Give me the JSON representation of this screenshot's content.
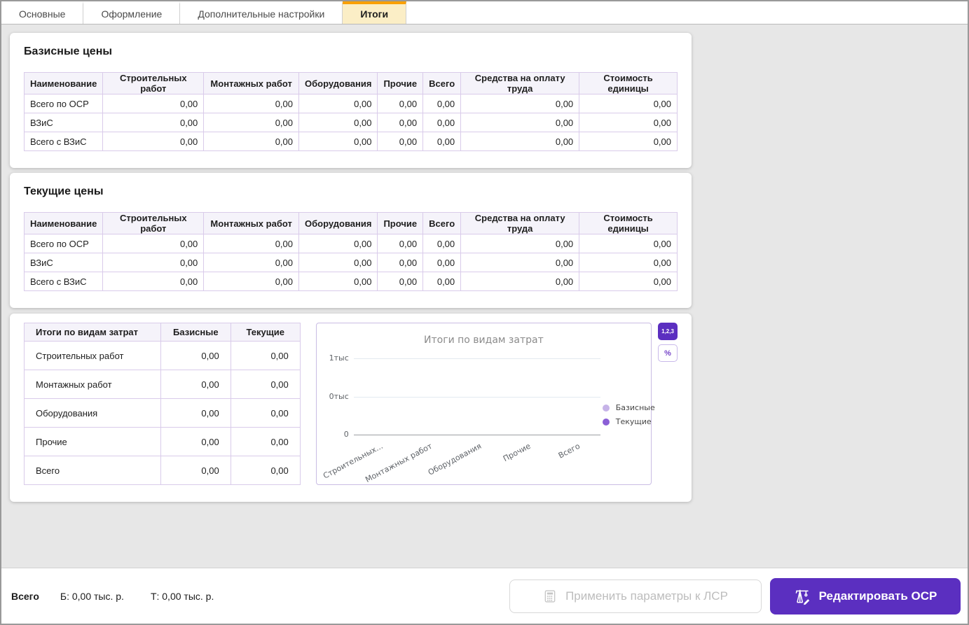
{
  "tabs": [
    {
      "label": "Основные",
      "active": false
    },
    {
      "label": "Оформление",
      "active": false
    },
    {
      "label": "Дополнительные настройки",
      "active": false
    },
    {
      "label": "Итоги",
      "active": true
    }
  ],
  "price_columns": [
    "Наименование",
    "Строительных работ",
    "Монтажных работ",
    "Оборудования",
    "Прочие",
    "Всего",
    "Средства на оплату труда",
    "Стоимость единицы"
  ],
  "sections": [
    {
      "title": "Базисные цены",
      "rows": [
        {
          "name": "Всего по ОСР",
          "values": [
            "0,00",
            "0,00",
            "0,00",
            "0,00",
            "0,00",
            "0,00",
            "0,00"
          ]
        },
        {
          "name": "ВЗиС",
          "values": [
            "0,00",
            "0,00",
            "0,00",
            "0,00",
            "0,00",
            "0,00",
            "0,00"
          ]
        },
        {
          "name": "Всего с ВЗиС",
          "values": [
            "0,00",
            "0,00",
            "0,00",
            "0,00",
            "0,00",
            "0,00",
            "0,00"
          ]
        }
      ]
    },
    {
      "title": "Текущие цены",
      "rows": [
        {
          "name": "Всего по ОСР",
          "values": [
            "0,00",
            "0,00",
            "0,00",
            "0,00",
            "0,00",
            "0,00",
            "0,00"
          ]
        },
        {
          "name": "ВЗиС",
          "values": [
            "0,00",
            "0,00",
            "0,00",
            "0,00",
            "0,00",
            "0,00",
            "0,00"
          ]
        },
        {
          "name": "Всего с ВЗиС",
          "values": [
            "0,00",
            "0,00",
            "0,00",
            "0,00",
            "0,00",
            "0,00",
            "0,00"
          ]
        }
      ]
    }
  ],
  "totals_table": {
    "headers": [
      "Итоги по видам затрат",
      "Базисные",
      "Текущие"
    ],
    "rows": [
      {
        "name": "Строительных работ",
        "base": "0,00",
        "current": "0,00"
      },
      {
        "name": "Монтажных работ",
        "base": "0,00",
        "current": "0,00"
      },
      {
        "name": "Оборудования",
        "base": "0,00",
        "current": "0,00"
      },
      {
        "name": "Прочие",
        "base": "0,00",
        "current": "0,00"
      },
      {
        "name": "Всего",
        "base": "0,00",
        "current": "0,00"
      }
    ]
  },
  "chart_data": {
    "type": "bar",
    "title": "Итоги по видам затрат",
    "categories": [
      "Строительных работ",
      "Монтажных работ",
      "Оборудования",
      "Прочие",
      "Всего"
    ],
    "x_tick_labels": [
      "Строительных...",
      "Монтажных работ",
      "Оборудования",
      "Прочие",
      "Всего"
    ],
    "series": [
      {
        "name": "Базисные",
        "values": [
          0,
          0,
          0,
          0,
          0
        ],
        "color": "#c6b3e8"
      },
      {
        "name": "Текущие",
        "values": [
          0,
          0,
          0,
          0,
          0
        ],
        "color": "#8b5fd6"
      }
    ],
    "y_ticks": [
      "1тыс",
      "0тыс",
      "0"
    ],
    "ylim": [
      0,
      1000
    ],
    "grid": true,
    "legend_position": "right"
  },
  "chart_toggles": {
    "values_label": "1,2,3",
    "percent_label": "%"
  },
  "footer": {
    "total_label": "Всего",
    "base_total": "Б: 0,00 тыс. р.",
    "current_total": "Т: 0,00 тыс. р.",
    "apply_button_label": "Применить параметры к ЛСР",
    "edit_button_label": "Редактировать ОСР"
  },
  "colors": {
    "accent_orange": "#f9a000",
    "active_tab_bg": "#fbeec6",
    "primary_purple": "#5b2fc0",
    "table_border": "#d9cbea",
    "table_header_bg": "#f5f3fa",
    "legend_base": "#c6b3e8",
    "legend_current": "#8b5fd6",
    "disabled_text": "#bdbdbd"
  }
}
